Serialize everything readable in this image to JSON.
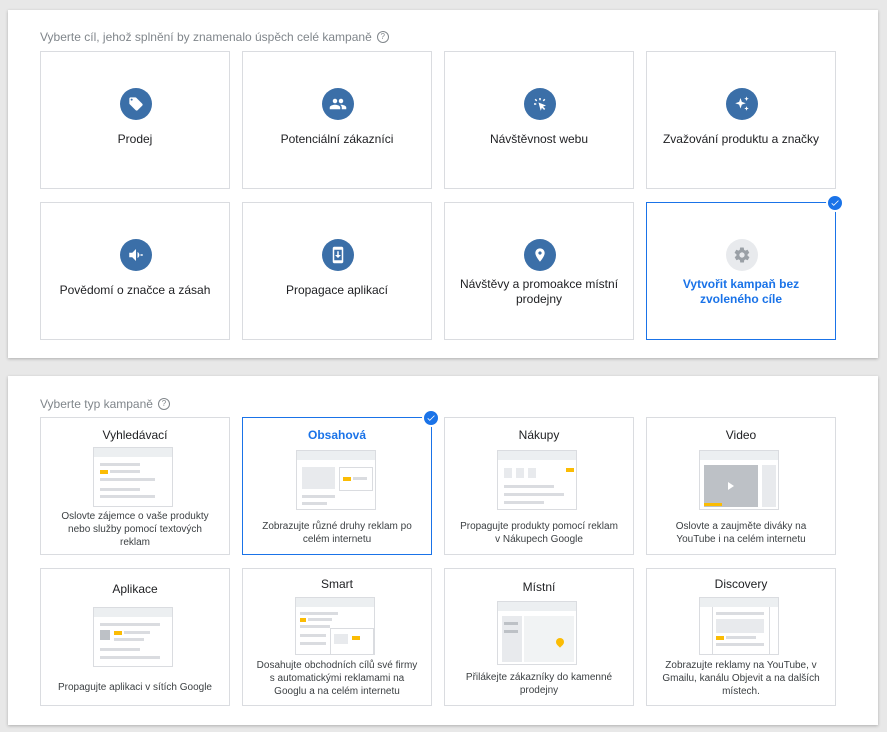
{
  "goal_section": {
    "heading": "Vyberte cíl, jehož splnění by znamenalo úspěch celé kampaně",
    "help": "?",
    "goals": [
      {
        "label": "Prodej",
        "icon": "tag-icon"
      },
      {
        "label": "Potenciální zákazníci",
        "icon": "people-icon"
      },
      {
        "label": "Návštěvnost webu",
        "icon": "cursor-click-icon"
      },
      {
        "label": "Zvažování produktu a značky",
        "icon": "sparkle-icon"
      },
      {
        "label": "Povědomí o značce a zásah",
        "icon": "speaker-icon"
      },
      {
        "label": "Propagace aplikací",
        "icon": "phone-download-icon"
      },
      {
        "label": "Návštěvy a promoakce místní prodejny",
        "icon": "location-pin-icon"
      },
      {
        "label": "Vytvořit kampaň bez zvoleného cíle",
        "icon": "gear-icon",
        "selected": true
      }
    ]
  },
  "type_section": {
    "heading": "Vyberte typ kampaně",
    "help": "?",
    "types": [
      {
        "title": "Vyhledávací",
        "desc": "Oslovte zájemce o vaše produkty nebo služby pomocí textových reklam"
      },
      {
        "title": "Obsahová",
        "desc": "Zobrazujte různé druhy reklam po celém internetu",
        "selected": true
      },
      {
        "title": "Nákupy",
        "desc": "Propagujte produkty pomocí reklam v Nákupech Google"
      },
      {
        "title": "Video",
        "desc": "Oslovte a zaujměte diváky na YouTube i na celém internetu"
      },
      {
        "title": "Aplikace",
        "desc": "Propagujte aplikaci v sítích Google"
      },
      {
        "title": "Smart",
        "desc": "Dosahujte obchodních cílů své firmy s automatickými reklamami na Googlu a na celém internetu"
      },
      {
        "title": "Místní",
        "desc": "Přilákejte zákazníky do kamenné prodejny"
      },
      {
        "title": "Discovery",
        "desc": "Zobrazujte reklamy na YouTube, v Gmailu, kanálu Objevit a na dalších místech."
      }
    ]
  },
  "colors": {
    "accent": "#1a73e8",
    "icon_bg": "#3b6fa8",
    "highlight": "#fbbc04"
  }
}
